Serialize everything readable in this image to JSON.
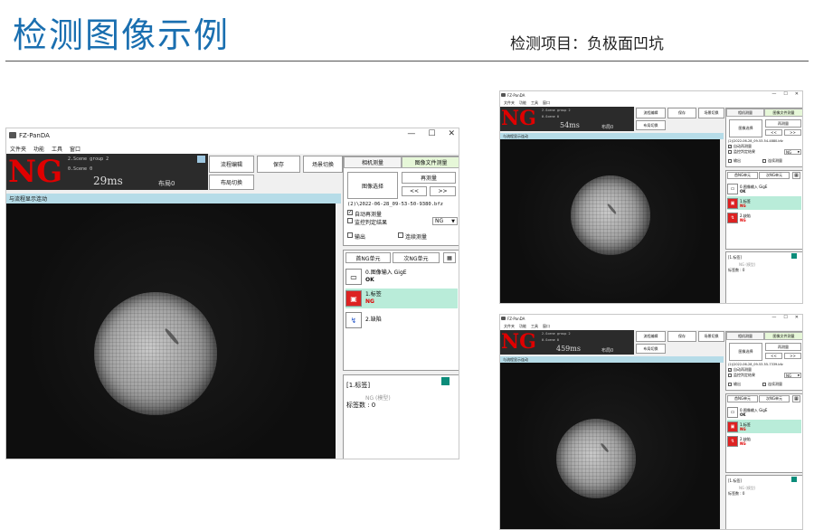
{
  "page": {
    "title": "检测图像示例",
    "subtitle": "检测项目：负极面凹坑"
  },
  "windows": [
    {
      "app_title": "FZ-PanDA",
      "controls": {
        "minimize": "—",
        "maximize": "☐",
        "close": "✕"
      },
      "menu": [
        "文件夹",
        "功能",
        "工具",
        "窗口"
      ],
      "status": {
        "result": "NG",
        "scene_group": "2.Scene group 2",
        "scene": "0.Scene 0",
        "time": "29ms",
        "layout": "布局0"
      },
      "buttons": {
        "flow_edit": "流程编辑",
        "save": "保存",
        "scene_switch": "场景切换",
        "layout_switch": "布局切换"
      },
      "viewer_title": "与流程显示连动",
      "tabs": {
        "camera": "相机测量",
        "image_file": "图像文件测量"
      },
      "image_select": "图像选择",
      "remeasure": "再测量",
      "prev": "<<",
      "next": ">>",
      "file_path": "(2)\\2022-06-28_09-53-50-9380.bfz",
      "auto_remeasure": "自动再测量",
      "monitor_result": "监控判定结果",
      "ng_option": "NG",
      "output": "输出",
      "continuous": "连续测量",
      "unit_tabs": {
        "first_ng": "首NG单元",
        "next_ng": "次NG单元"
      },
      "units": [
        {
          "name": "0.图像输入 GigE",
          "result": "OK"
        },
        {
          "name": "1.标签",
          "result": "NG"
        },
        {
          "name": "2.缺陷",
          "result": ""
        }
      ],
      "log": {
        "header": "[1.标签]",
        "sub": "NG (模型)",
        "count": "标签数 : 0"
      }
    },
    {
      "app_title": "FZ-PanDA",
      "controls": {
        "minimize": "—",
        "maximize": "☐",
        "close": "✕"
      },
      "menu": [
        "文件夹",
        "功能",
        "工具",
        "窗口"
      ],
      "status": {
        "result": "NG",
        "scene_group": "2.Scene group 2",
        "scene": "0.Scene 0",
        "time": "54ms",
        "layout": "布局0"
      },
      "buttons": {
        "flow_edit": "流程编辑",
        "save": "保存",
        "scene_switch": "场景切换",
        "layout_switch": "布局切换"
      },
      "viewer_title": "与流程显示连动",
      "tabs": {
        "camera": "相机测量",
        "image_file": "图像文件测量"
      },
      "image_select": "图像选择",
      "remeasure": "再测量",
      "prev": "<<",
      "next": ">>",
      "file_path": "(2)\\2022-06-28_09-53-54-4880.bfz",
      "auto_remeasure": "自动再测量",
      "monitor_result": "监控判定结果",
      "ng_option": "NG",
      "output": "输出",
      "continuous": "连续测量",
      "unit_tabs": {
        "first_ng": "首NG单元",
        "next_ng": "次NG单元"
      },
      "units": [
        {
          "name": "0.图像输入 GigE",
          "result": "OK"
        },
        {
          "name": "1.标签",
          "result": "NG"
        },
        {
          "name": "2.缺陷",
          "result": "NG"
        }
      ],
      "log": {
        "header": "[1.标签]",
        "sub": "NG (模型)",
        "count": "标签数 : 0"
      }
    },
    {
      "app_title": "FZ-PanDA",
      "controls": {
        "minimize": "—",
        "maximize": "☐",
        "close": "✕"
      },
      "menu": [
        "文件夹",
        "功能",
        "工具",
        "窗口"
      ],
      "status": {
        "result": "NG",
        "scene_group": "2.Scene group 2",
        "scene": "0.Scene 0",
        "time": "459ms",
        "layout": "布局0"
      },
      "buttons": {
        "flow_edit": "流程编辑",
        "save": "保存",
        "scene_switch": "场景切换",
        "layout_switch": "布局切换"
      },
      "viewer_title": "与流程显示连动",
      "tabs": {
        "camera": "相机测量",
        "image_file": "图像文件测量"
      },
      "image_select": "图像选择",
      "remeasure": "再测量",
      "prev": "<<",
      "next": ">>",
      "file_path": "(2)\\2022-06-28_09-53-55-7339.bfz",
      "auto_remeasure": "自动再测量",
      "monitor_result": "监控判定结果",
      "ng_option": "NG",
      "output": "输出",
      "continuous": "连续测量",
      "unit_tabs": {
        "first_ng": "首NG单元",
        "next_ng": "次NG单元"
      },
      "units": [
        {
          "name": "0.图像输入 GigE",
          "result": "OK"
        },
        {
          "name": "1.标签",
          "result": "NG"
        },
        {
          "name": "2.缺陷",
          "result": "NG"
        }
      ],
      "log": {
        "header": "[1.标签]",
        "sub": "NG (模型)",
        "count": "标签数 : 0"
      }
    }
  ]
}
